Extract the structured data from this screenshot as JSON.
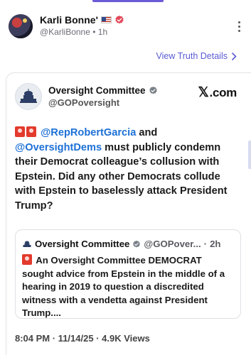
{
  "post": {
    "display_name": "Karli Bonne'",
    "handle": "@KarliBonne",
    "time": "1h",
    "view_details_label": "View Truth Details"
  },
  "tweet": {
    "account_name": "Oversight Committee",
    "account_handle": "@GOPoversight",
    "brand": "X.com",
    "brand_mark": "𝕏",
    "brand_text": ".com",
    "mention_1": "@RepRobertGarcia",
    "text_1": " and ",
    "mention_2": "@OversightDems",
    "text_2": " must publicly condemn their Democrat colleague’s collusion with Epstein. Did any other Democrats collude with Epstein to baselessly attack President Trump?",
    "timestamp": "8:04 PM · 11/14/25 · 4.9K Views"
  },
  "quote": {
    "account_name": "Oversight Committee",
    "handle_truncated": "@GOPover...",
    "time": "2h",
    "text": "An Oversight Committee DEMOCRAT sought advice from Epstein in the middle of a hearing in 2019 to question a discredited witness with a vendetta against President Trump...."
  },
  "icons": {
    "avatar": "avatar-image",
    "flag": "us-flag-icon",
    "verified": "verified-badge-icon",
    "more": "more-vertical-icon",
    "chevron": "chevron-right-icon",
    "siren": "police-siren-icon"
  },
  "colors": {
    "accent": "#5b5bd6",
    "mention": "#1d70d6",
    "verified": "#e3495b",
    "siren": "#e23a2c"
  }
}
